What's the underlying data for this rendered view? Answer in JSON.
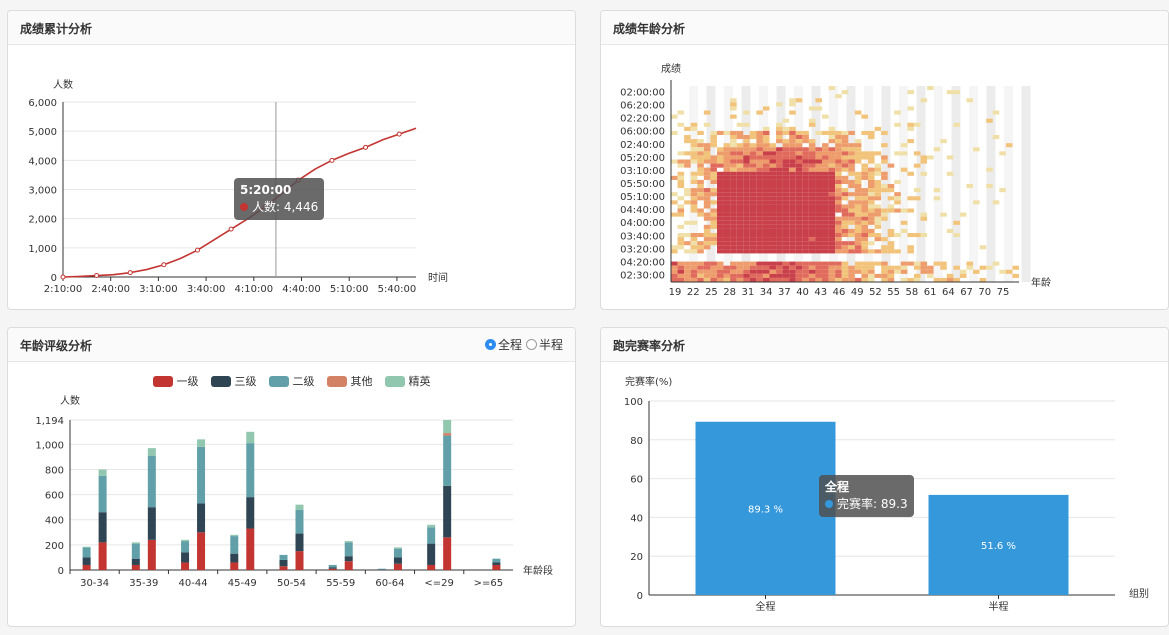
{
  "panels": {
    "cumulative": {
      "title": "成绩累计分析"
    },
    "heatmap": {
      "title": "成绩年龄分析"
    },
    "age_level": {
      "title": "年龄评级分析",
      "radio_full": "全程",
      "radio_half": "半程",
      "selected": "全程"
    },
    "completion": {
      "title": "跑完赛率分析"
    }
  },
  "tooltips": {
    "cumulative": {
      "time": "5:20:00",
      "label": "人数: 4,446",
      "color": "#c23531"
    },
    "completion": {
      "title": "全程",
      "label": "完赛率: 89.3",
      "color": "#3498db"
    }
  },
  "chart_data": [
    {
      "id": "cumulative",
      "type": "line",
      "ylabel": "人数",
      "xlabel": "时间",
      "ylim": [
        0,
        6000
      ],
      "yticks": [
        "0",
        "1,000",
        "2,000",
        "3,000",
        "4,000",
        "5,000",
        "6,000"
      ],
      "xticks": [
        "2:10:00",
        "2:40:00",
        "3:10:00",
        "3:40:00",
        "4:10:00",
        "4:40:00",
        "5:10:00",
        "5:40:00"
      ],
      "x_minutes_from_2_10": [
        0,
        15,
        30,
        45,
        60,
        75,
        90,
        105,
        120,
        135,
        150,
        165,
        180,
        195,
        210,
        225,
        240,
        255,
        270,
        285,
        300,
        315
      ],
      "y": [
        0,
        20,
        50,
        80,
        150,
        260,
        420,
        640,
        920,
        1280,
        1640,
        2000,
        2400,
        2850,
        3320,
        3700,
        4000,
        4240,
        4446,
        4700,
        4900,
        5100
      ],
      "highlight_x_minutes": 190,
      "color": "#c23531"
    },
    {
      "id": "heatmap",
      "type": "heatmap",
      "ylabel": "成绩",
      "xlabel": "年龄",
      "yticks": [
        "02:30:00",
        "04:20:00",
        "03:20:00",
        "03:40:00",
        "04:00:00",
        "04:40:00",
        "05:10:00",
        "05:50:00",
        "03:10:00",
        "05:20:00",
        "02:40:00",
        "06:00:00",
        "02:20:00",
        "06:20:00",
        "02:00:00"
      ],
      "xticks": [
        "19",
        "22",
        "25",
        "28",
        "31",
        "34",
        "37",
        "40",
        "43",
        "46",
        "49",
        "52",
        "55",
        "58",
        "61",
        "64",
        "67",
        "70",
        "75"
      ],
      "colors": [
        "#f0e0a8",
        "#f2c37a",
        "#ee9c6c",
        "#e06a5c",
        "#c9404a"
      ]
    },
    {
      "id": "age_level",
      "type": "bar",
      "ylabel": "人数",
      "xlabel": "年龄段",
      "ylim": [
        0,
        1194
      ],
      "yticks": [
        "0",
        "200",
        "400",
        "600",
        "800",
        "1,000",
        "1,194"
      ],
      "categories": [
        "30-34",
        "35-39",
        "40-44",
        "45-49",
        "50-54",
        "55-59",
        "60-64",
        "<=29",
        ">=65"
      ],
      "series": [
        {
          "name": "一级",
          "color": "#c23531"
        },
        {
          "name": "三级",
          "color": "#2f4554"
        },
        {
          "name": "二级",
          "color": "#61a0a8"
        },
        {
          "name": "其他",
          "color": "#d48265"
        },
        {
          "name": "精英",
          "color": "#91c7ae"
        }
      ],
      "groups": [
        [
          [
            40,
            60,
            80,
            0,
            5
          ],
          [
            220,
            240,
            290,
            0,
            50
          ]
        ],
        [
          [
            40,
            50,
            120,
            0,
            10
          ],
          [
            240,
            260,
            410,
            0,
            60
          ]
        ],
        [
          [
            60,
            80,
            90,
            0,
            10
          ],
          [
            300,
            230,
            450,
            0,
            60
          ]
        ],
        [
          [
            60,
            70,
            140,
            0,
            10
          ],
          [
            330,
            250,
            430,
            0,
            90
          ]
        ],
        [
          [
            30,
            50,
            40,
            0,
            0
          ],
          [
            150,
            140,
            190,
            0,
            40
          ]
        ],
        [
          [
            10,
            10,
            20,
            0,
            0
          ],
          [
            70,
            40,
            110,
            0,
            10
          ]
        ],
        [
          [
            0,
            5,
            5,
            0,
            0
          ],
          [
            50,
            50,
            70,
            0,
            10
          ]
        ],
        [
          [
            40,
            170,
            130,
            0,
            20
          ],
          [
            260,
            410,
            400,
            20,
            104
          ]
        ],
        [
          [
            0,
            0,
            0,
            0,
            0
          ],
          [
            40,
            20,
            30,
            0,
            0
          ]
        ]
      ]
    },
    {
      "id": "completion",
      "type": "bar",
      "ylabel": "完赛率(%)",
      "xlabel": "组别",
      "ylim": [
        0,
        100
      ],
      "yticks": [
        "0",
        "20",
        "40",
        "60",
        "80",
        "100"
      ],
      "categories": [
        "全程",
        "半程"
      ],
      "values": [
        89.3,
        51.6
      ],
      "data_labels": [
        "89.3 %",
        "51.6 %"
      ],
      "color": "#3498db"
    }
  ]
}
